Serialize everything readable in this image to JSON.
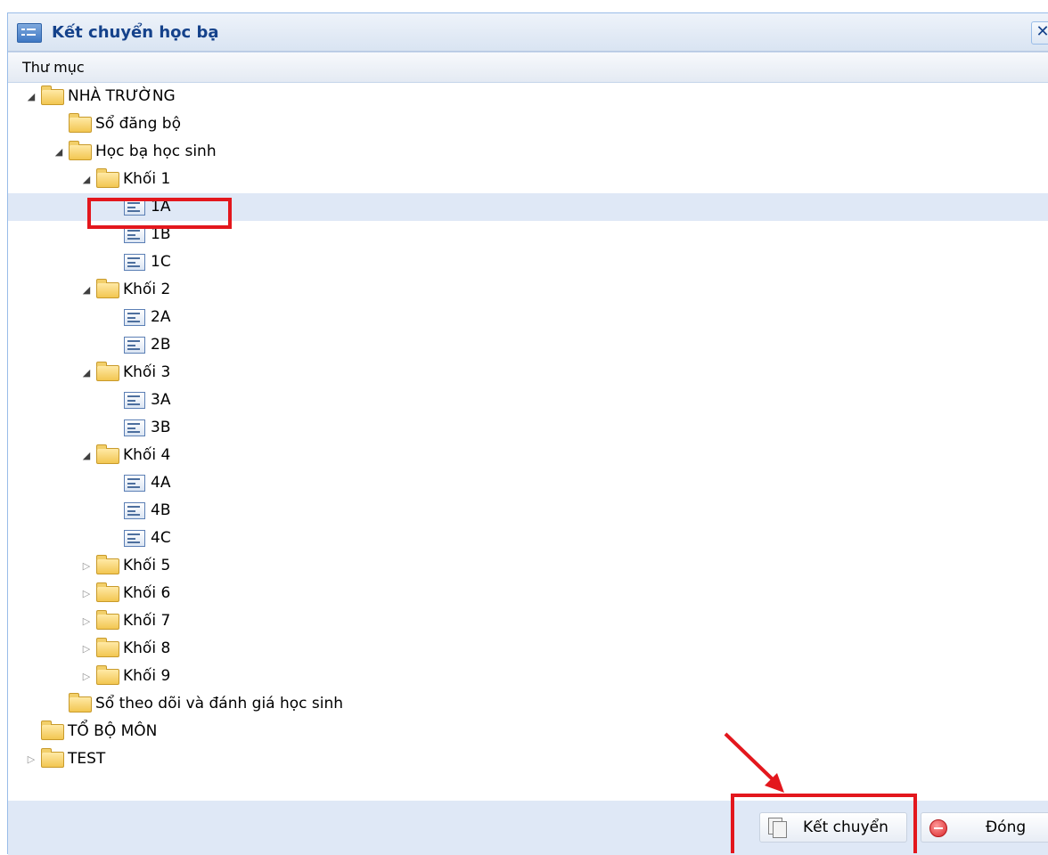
{
  "window": {
    "title": "Kết chuyển học bạ",
    "close_symbol": "✕"
  },
  "panel": {
    "header": "Thư mục"
  },
  "tree": [
    {
      "label": "NHÀ TRƯỜNG",
      "type": "folder",
      "level": 0,
      "arrow": "expanded"
    },
    {
      "label": "Sổ đăng bộ",
      "type": "folder",
      "level": 1,
      "arrow": "none"
    },
    {
      "label": "Học bạ học sinh",
      "type": "folder",
      "level": 1,
      "arrow": "expanded"
    },
    {
      "label": "Khối 1",
      "type": "folder",
      "level": 2,
      "arrow": "expanded"
    },
    {
      "label": "1A",
      "type": "doc",
      "level": 3,
      "arrow": "none",
      "selected": true
    },
    {
      "label": "1B",
      "type": "doc",
      "level": 3,
      "arrow": "none"
    },
    {
      "label": "1C",
      "type": "doc",
      "level": 3,
      "arrow": "none"
    },
    {
      "label": "Khối 2",
      "type": "folder",
      "level": 2,
      "arrow": "expanded"
    },
    {
      "label": "2A",
      "type": "doc",
      "level": 3,
      "arrow": "none"
    },
    {
      "label": "2B",
      "type": "doc",
      "level": 3,
      "arrow": "none"
    },
    {
      "label": "Khối 3",
      "type": "folder",
      "level": 2,
      "arrow": "expanded"
    },
    {
      "label": "3A",
      "type": "doc",
      "level": 3,
      "arrow": "none"
    },
    {
      "label": "3B",
      "type": "doc",
      "level": 3,
      "arrow": "none"
    },
    {
      "label": "Khối 4",
      "type": "folder",
      "level": 2,
      "arrow": "expanded"
    },
    {
      "label": "4A",
      "type": "doc",
      "level": 3,
      "arrow": "none"
    },
    {
      "label": "4B",
      "type": "doc",
      "level": 3,
      "arrow": "none"
    },
    {
      "label": "4C",
      "type": "doc",
      "level": 3,
      "arrow": "none"
    },
    {
      "label": "Khối 5",
      "type": "folder",
      "level": 2,
      "arrow": "collapsed"
    },
    {
      "label": "Khối 6",
      "type": "folder",
      "level": 2,
      "arrow": "collapsed"
    },
    {
      "label": "Khối 7",
      "type": "folder",
      "level": 2,
      "arrow": "collapsed"
    },
    {
      "label": "Khối 8",
      "type": "folder",
      "level": 2,
      "arrow": "collapsed"
    },
    {
      "label": "Khối 9",
      "type": "folder",
      "level": 2,
      "arrow": "collapsed"
    },
    {
      "label": "Sổ theo dõi và đánh giá học sinh",
      "type": "folder",
      "level": 1,
      "arrow": "none"
    },
    {
      "label": "TỔ BỘ MÔN",
      "type": "folder",
      "level": 0,
      "arrow": "none"
    },
    {
      "label": "TEST",
      "type": "folder",
      "level": 0,
      "arrow": "collapsed"
    }
  ],
  "footer": {
    "transfer_label": "Kết chuyển",
    "close_label": "Đóng"
  },
  "colors": {
    "title_text": "#15428b",
    "window_bg": "#dfe8f6",
    "selected_row": "#dfe8f6",
    "annotation": "#e3171d"
  }
}
